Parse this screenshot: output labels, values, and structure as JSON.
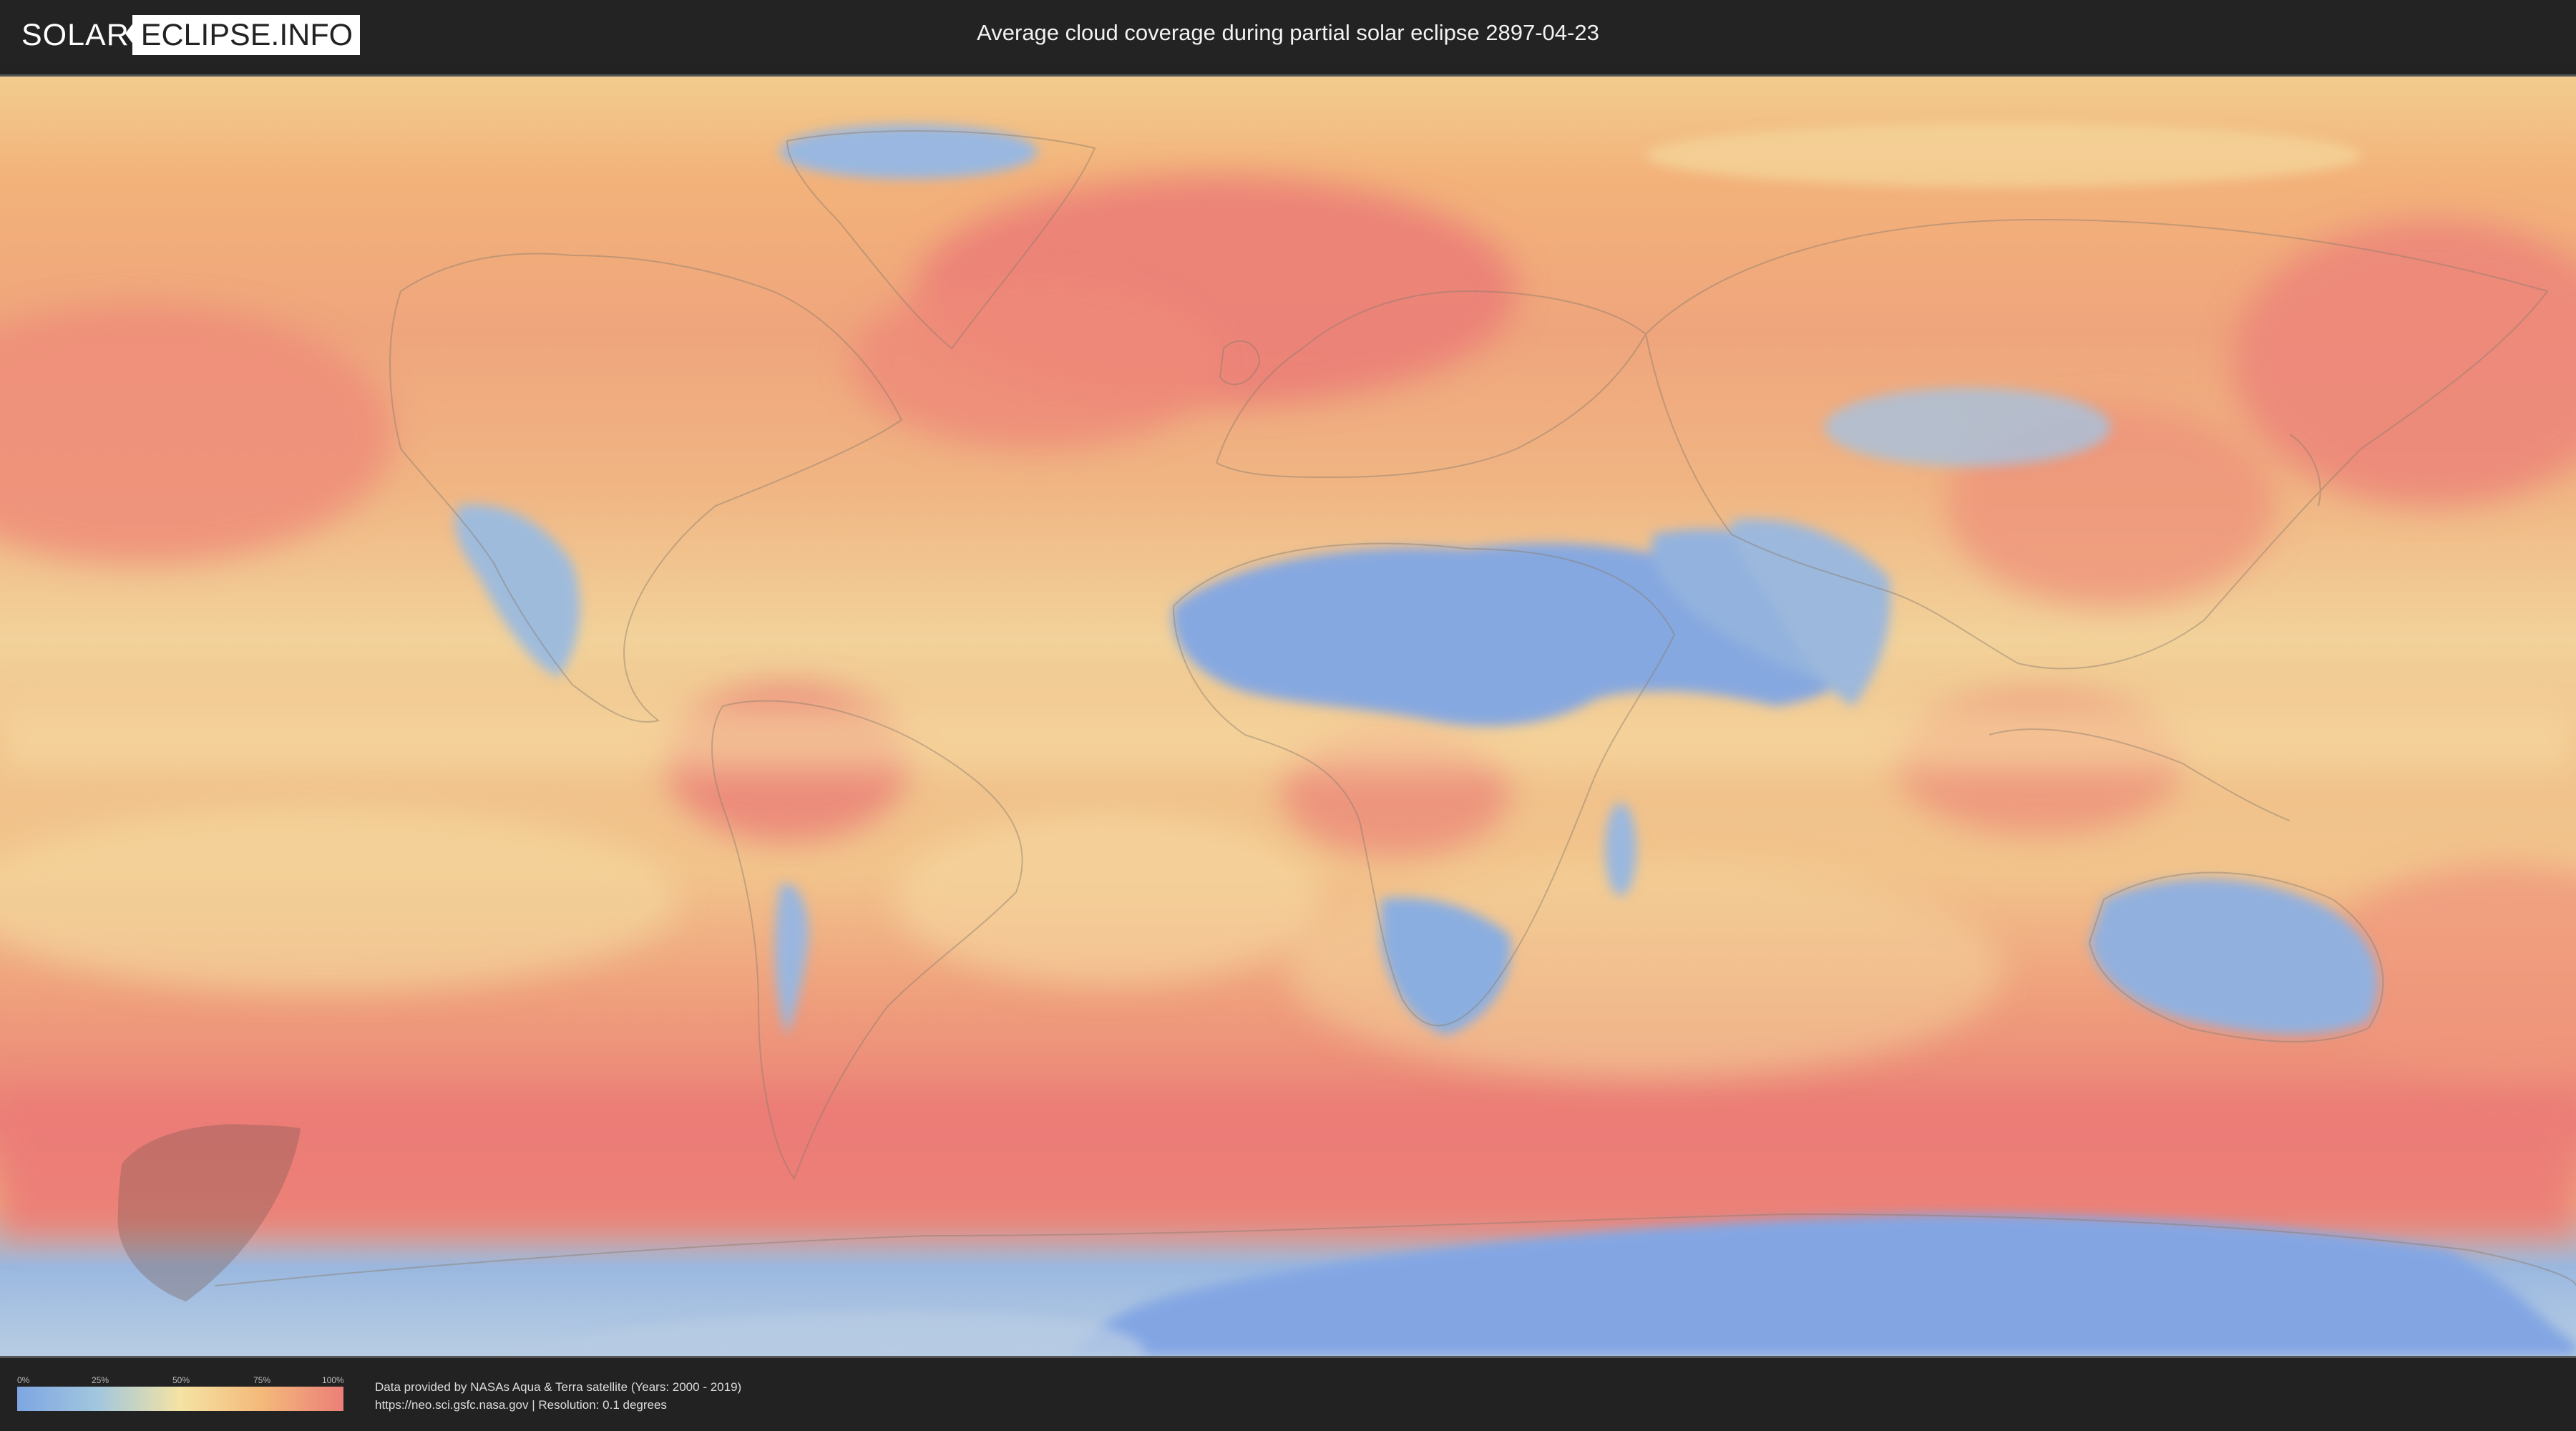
{
  "header": {
    "logo_left": "SOLAR",
    "logo_right": "ECLIPSE.INFO",
    "title": "Average cloud coverage during partial solar eclipse 2897-04-23"
  },
  "map": {
    "description_colors": {
      "low": "#7ea6e3",
      "mid": "#f4e3a3",
      "high": "#eb7f78"
    },
    "eclipse_shadow_color": "#7a5a50"
  },
  "legend": {
    "ticks": [
      "0%",
      "25%",
      "50%",
      "75%",
      "100%"
    ]
  },
  "credits": {
    "line1": "Data provided by NASAs Aqua & Terra satellite (Years: 2000 - 2019)",
    "line2": "https://neo.sci.gsfc.nasa.gov | Resolution: 0.1 degrees"
  }
}
